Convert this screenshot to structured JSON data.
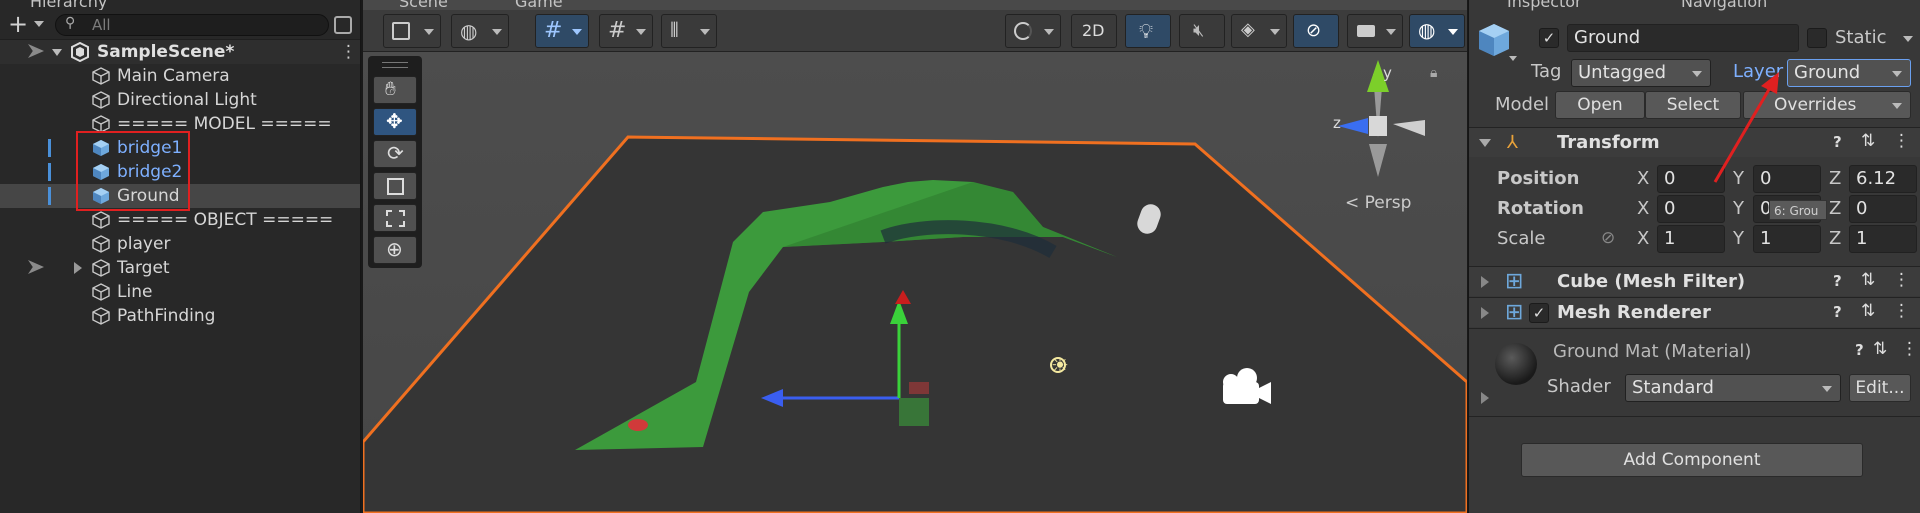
{
  "hierarchy": {
    "tab_label": "Hierarchy",
    "search_placeholder": "All",
    "scene_name": "SampleScene*",
    "items": [
      {
        "label": "Main Camera",
        "selected": false
      },
      {
        "label": "Directional Light",
        "selected": false
      },
      {
        "label": "===== MODEL =====",
        "selected": false
      },
      {
        "label": "bridge1",
        "selected": false
      },
      {
        "label": "bridge2",
        "selected": false
      },
      {
        "label": "Ground",
        "selected": true
      },
      {
        "label": "===== OBJECT =====",
        "selected": false
      },
      {
        "label": "player",
        "selected": false
      },
      {
        "label": "Target",
        "selected": false
      },
      {
        "label": "Line",
        "selected": false
      },
      {
        "label": "PathFinding",
        "selected": false
      }
    ]
  },
  "scene": {
    "tab_scene": "Scene",
    "tab_game": "Game",
    "btn_2d": "2D",
    "persp_label": "< Persp",
    "gizmo_y": "y",
    "gizmo_z": "z"
  },
  "inspector": {
    "tab_inspector": "Inspector",
    "tab_navigation": "Navigation",
    "object_name": "Ground",
    "static_label": "Static",
    "tag_label": "Tag",
    "tag_value": "Untagged",
    "layer_label": "Layer",
    "layer_value": "Ground",
    "model_label": "Model",
    "btn_open": "Open",
    "btn_select": "Select",
    "btn_overrides": "Overrides",
    "transform": {
      "title": "Transform",
      "position_label": "Position",
      "rotation_label": "Rotation",
      "scale_label": "Scale",
      "pos": {
        "x": "0",
        "y": "0",
        "z": "6.12"
      },
      "rot": {
        "x": "0",
        "y": "0",
        "z": "0"
      },
      "scale": {
        "x": "1",
        "y": "1",
        "z": "1"
      },
      "tooltip": "6: Grou"
    },
    "mesh_filter_title": "Cube (Mesh Filter)",
    "mesh_renderer_title": "Mesh Renderer",
    "material_name": "Ground Mat (Material)",
    "shader_label": "Shader",
    "shader_value": "Standard",
    "edit_label": "Edit...",
    "add_component": "Add Component",
    "axis_x": "X",
    "axis_y": "Y",
    "axis_z": "Z"
  },
  "colors": {
    "selection_blue": "#7eb0ff",
    "annotation_red": "#e02020",
    "ground_green": "#3c9a3c",
    "plane_orange": "#f07020"
  }
}
